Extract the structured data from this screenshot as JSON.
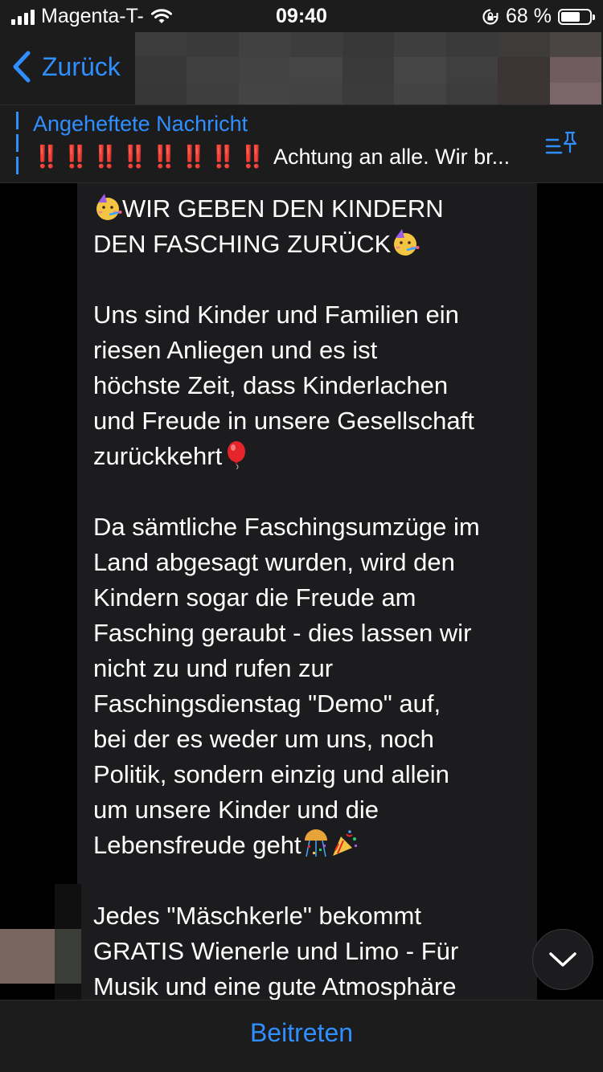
{
  "status_bar": {
    "carrier": "Magenta-T-",
    "time": "09:40",
    "battery_percent_label": "68 %",
    "battery_level": 0.68,
    "icons": [
      "signal-bars-icon",
      "wifi-icon",
      "rotation-lock-icon",
      "battery-icon"
    ]
  },
  "nav": {
    "back_label": "Zurück",
    "back_icon": "chevron-left-icon",
    "header_redacted": true
  },
  "pinned": {
    "title": "Angeheftete Nachricht",
    "marks": "‼️‼️‼️‼️‼️‼️‼️‼️",
    "preview": " Achtung an alle. Wir br...",
    "list_icon": "pinned-list-icon"
  },
  "message": {
    "heading_line1": "WIR GEBEN DEN KINDERN",
    "heading_line2": "DEN FASCHING ZURÜCK",
    "paragraph1": "Uns sind Kinder und Familien ein\nriesen Anliegen  und es ist\nhöchste Zeit, dass Kinderlachen\nund Freude in unsere Gesellschaft\nzurückkehrt",
    "paragraph2": "Da sämtliche Faschingsumzüge im\nLand abgesagt wurden, wird den\nKindern sogar die Freude am\nFasching geraubt - dies lassen wir\nnicht zu und rufen zur\nFaschingsdienstag \"Demo\" auf,\nbei der es weder um uns, noch\nPolitik, sondern einzig und allein\num unsere Kinder und die\nLebensfreude geht",
    "paragraph3": "Jedes \"Mäschkerle\" bekommt\nGRATIS Wienerle und Limo - Für\nMusik und eine gute Atmosphäre",
    "emojis": [
      "party-face-emoji",
      "party-face-emoji",
      "balloon-emoji",
      "confetti-ball-emoji",
      "party-popper-emoji"
    ]
  },
  "scroll_down_icon": "chevron-down-icon",
  "bottom": {
    "join_label": "Beitreten"
  },
  "colors": {
    "accent": "#2f8fff",
    "bars": "#1c1c1d",
    "bubble": "#1c1c1e",
    "warning": "#e8262b"
  }
}
